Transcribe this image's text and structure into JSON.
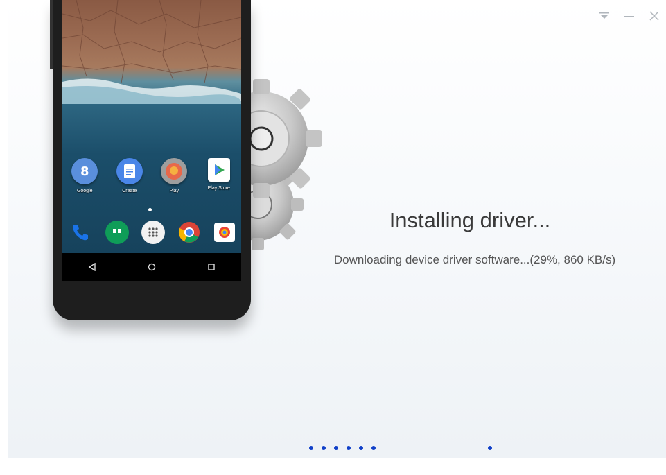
{
  "window": {
    "controls": {
      "dropdown": "dropdown-icon",
      "minimize": "minimize-icon",
      "close": "close-icon"
    }
  },
  "phone": {
    "apps": [
      {
        "label": "Google",
        "icon": "google-icon",
        "color": "#5a8fdc",
        "glyph": "8"
      },
      {
        "label": "Create",
        "icon": "docs-icon",
        "color": "#4a86e8",
        "glyph": "≡"
      },
      {
        "label": "Play",
        "icon": "play-games-icon",
        "color": "#e8684a",
        "glyph": "●"
      },
      {
        "label": "Play Store",
        "icon": "play-store-icon",
        "color": "#ffffff",
        "glyph": "▶"
      }
    ],
    "dock": [
      {
        "icon": "phone-icon",
        "color": "#1a73e8",
        "glyph": "✆"
      },
      {
        "icon": "hangouts-icon",
        "color": "#0f9d58",
        "glyph": "❞"
      },
      {
        "icon": "app-drawer-icon",
        "color": "#f2f2f2",
        "glyph": "⋮"
      },
      {
        "icon": "chrome-icon",
        "color": "#db4437",
        "glyph": "◉"
      },
      {
        "icon": "photos-icon",
        "color": "#ffffff",
        "glyph": "◐"
      }
    ],
    "nav": [
      "back-icon",
      "home-icon",
      "recents-icon"
    ]
  },
  "status": {
    "title": "Installing driver...",
    "detail": "Downloading device driver software...(29%, 860 KB/s)",
    "progress_percent": 29,
    "speed": "860 KB/s"
  },
  "colors": {
    "accent": "#1040c8",
    "text": "#3a3a3a"
  }
}
